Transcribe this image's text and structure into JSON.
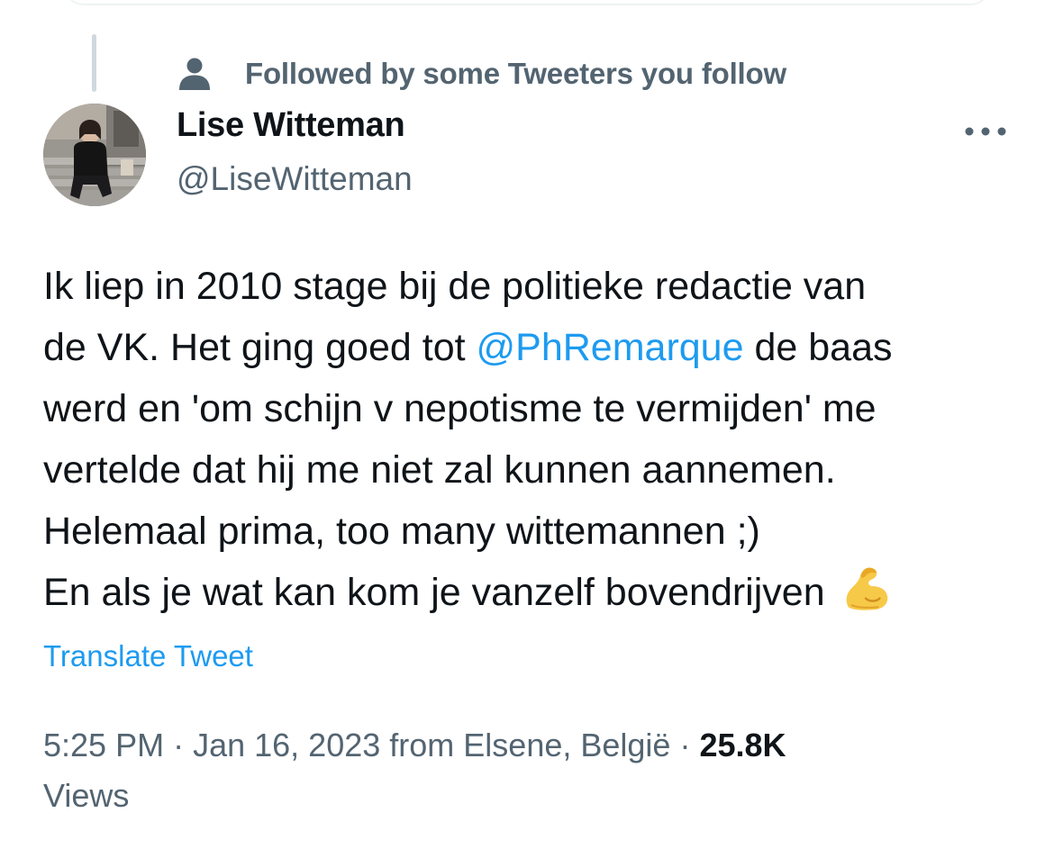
{
  "social_context": {
    "text": "Followed by some Tweeters you follow",
    "icon": "person-icon"
  },
  "author": {
    "name": "Lise Witteman",
    "handle": "@LiseWitteman"
  },
  "tweet": {
    "lines": [
      {
        "text": "Ik liep in 2010 stage bij de politieke redactie van"
      },
      {
        "before": "de VK. Het ging goed tot ",
        "mention": "@PhRemarque",
        "after": " de baas"
      },
      {
        "text": "werd en 'om schijn v nepotisme te vermijden' me"
      },
      {
        "text": "vertelde dat hij me niet zal kunnen aannemen."
      },
      {
        "text": "Helemaal prima, too many wittemannen ;)"
      },
      {
        "text": "En als je wat kan kom je vanzelf bovendrijven",
        "emoji": "flexed-biceps-icon"
      }
    ]
  },
  "translate_label": "Translate Tweet",
  "meta": {
    "time": "5:25 PM",
    "separator": " · ",
    "date": "Jan 16, 2023",
    "location_prefix": " from ",
    "location": "Elsene, België",
    "separator2": " · ",
    "views_count": "25.8K",
    "views_label": "Views"
  },
  "colors": {
    "link": "#1d9bf0",
    "secondary_text": "#536471",
    "primary_text": "#0f1419",
    "thread_line": "#cfd9de"
  }
}
